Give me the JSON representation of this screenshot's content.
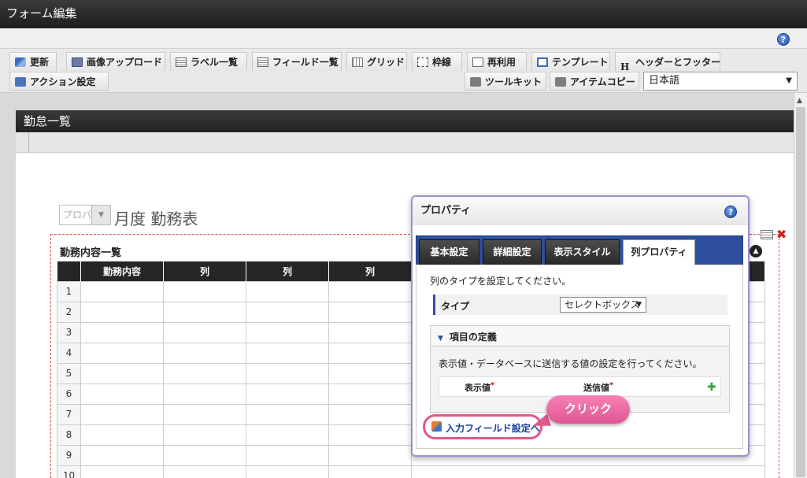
{
  "window": {
    "title": "フォーム編集"
  },
  "toolbar": {
    "row1": [
      "更新",
      "画像アップロード",
      "ラベル一覧",
      "フィールド一覧",
      "グリッド",
      "枠線",
      "再利用",
      "テンプレート",
      "ヘッダーとフッター"
    ],
    "row2_left": [
      "アクション設定"
    ],
    "row2_right": [
      "ツールキット",
      "アイテムコピー"
    ],
    "language": "日本語",
    "h_glyph": "H"
  },
  "form": {
    "title": "勤怠一覧",
    "month_placeholder": "プロパ",
    "month_label": "月度 勤務表",
    "table_title": "勤務内容一覧",
    "columns": [
      "勤務内容",
      "列",
      "列",
      "列"
    ],
    "row_numbers": [
      "1",
      "2",
      "3",
      "4",
      "5",
      "6",
      "7",
      "8",
      "9",
      "10"
    ]
  },
  "panel": {
    "title": "プロパティ",
    "tabs": [
      "基本設定",
      "詳細設定",
      "表示スタイル",
      "列プロパティ"
    ],
    "active_tab": "列プロパティ",
    "description": "列のタイプを設定してください。",
    "type_label": "タイプ",
    "type_value": "セレクトボックス",
    "section_title": "項目の定義",
    "section_description": "表示値・データベースに送信する値の設定を行ってください。",
    "col_display": "表示値",
    "col_send": "送信値",
    "required_mark": "*",
    "link_text": "入力フィールド設定へ"
  },
  "callout": {
    "text": "クリック"
  },
  "help_symbol": "?"
}
